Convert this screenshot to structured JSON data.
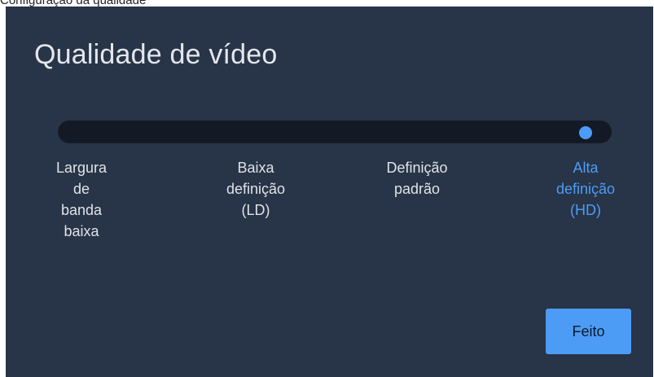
{
  "caption": "Configuração da qualidade",
  "dialog": {
    "title": "Qualidade de vídeo",
    "slider": {
      "selected_index": 3,
      "stops": [
        {
          "lines": [
            "Largura",
            "de",
            "banda",
            "baixa"
          ]
        },
        {
          "lines": [
            "Baixa",
            "definição",
            "(LD)"
          ]
        },
        {
          "lines": [
            "Definição",
            "padrão"
          ]
        },
        {
          "lines": [
            "Alta",
            "definição",
            "(HD)"
          ]
        }
      ]
    },
    "done_label": "Feito"
  },
  "colors": {
    "dialog_background": "#283447",
    "track": "#131a26",
    "accent": "#4c9cf6",
    "text": "#dfe3e9"
  }
}
